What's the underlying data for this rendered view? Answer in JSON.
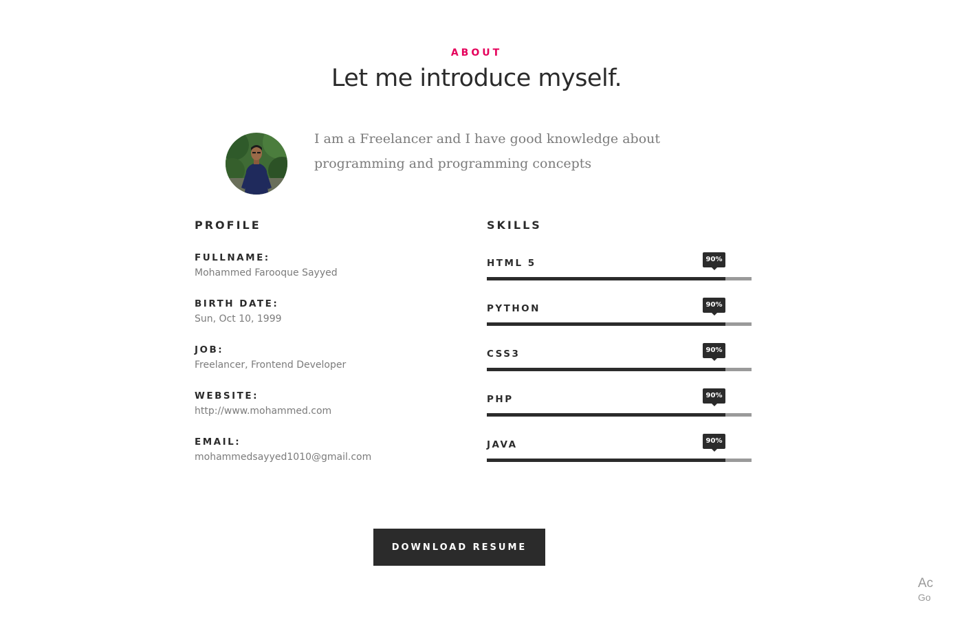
{
  "header": {
    "eyebrow": "ABOUT",
    "title": "Let me introduce myself."
  },
  "intro": {
    "text": "I am a Freelancer and I have good knowledge about programming and programming concepts",
    "avatar_icon": "profile-photo"
  },
  "profile": {
    "title": "PROFILE",
    "items": [
      {
        "label": "FULLNAME:",
        "value": "Mohammed Farooque Sayyed"
      },
      {
        "label": "BIRTH DATE:",
        "value": "Sun, Oct 10, 1999"
      },
      {
        "label": "JOB:",
        "value": "Freelancer, Frontend Developer"
      },
      {
        "label": "WEBSITE:",
        "value": "http://www.mohammed.com"
      },
      {
        "label": "EMAIL:",
        "value": "mohammedsayyed1010@gmail.com"
      }
    ]
  },
  "skills": {
    "title": "SKILLS",
    "items": [
      {
        "name": "HTML 5",
        "percent": 90,
        "label": "90%"
      },
      {
        "name": "PYTHON",
        "percent": 90,
        "label": "90%"
      },
      {
        "name": "CSS3",
        "percent": 90,
        "label": "90%"
      },
      {
        "name": "PHP",
        "percent": 90,
        "label": "90%"
      },
      {
        "name": "JAVA",
        "percent": 90,
        "label": "90%"
      }
    ]
  },
  "actions": {
    "download_label": "DOWNLOAD RESUME"
  },
  "watermark": {
    "line1": "Ac",
    "line2": "Go"
  },
  "colors": {
    "accent": "#e5005b",
    "dark": "#2b2b2b",
    "muted": "#7b7b7b",
    "track": "#9a9a9a"
  }
}
